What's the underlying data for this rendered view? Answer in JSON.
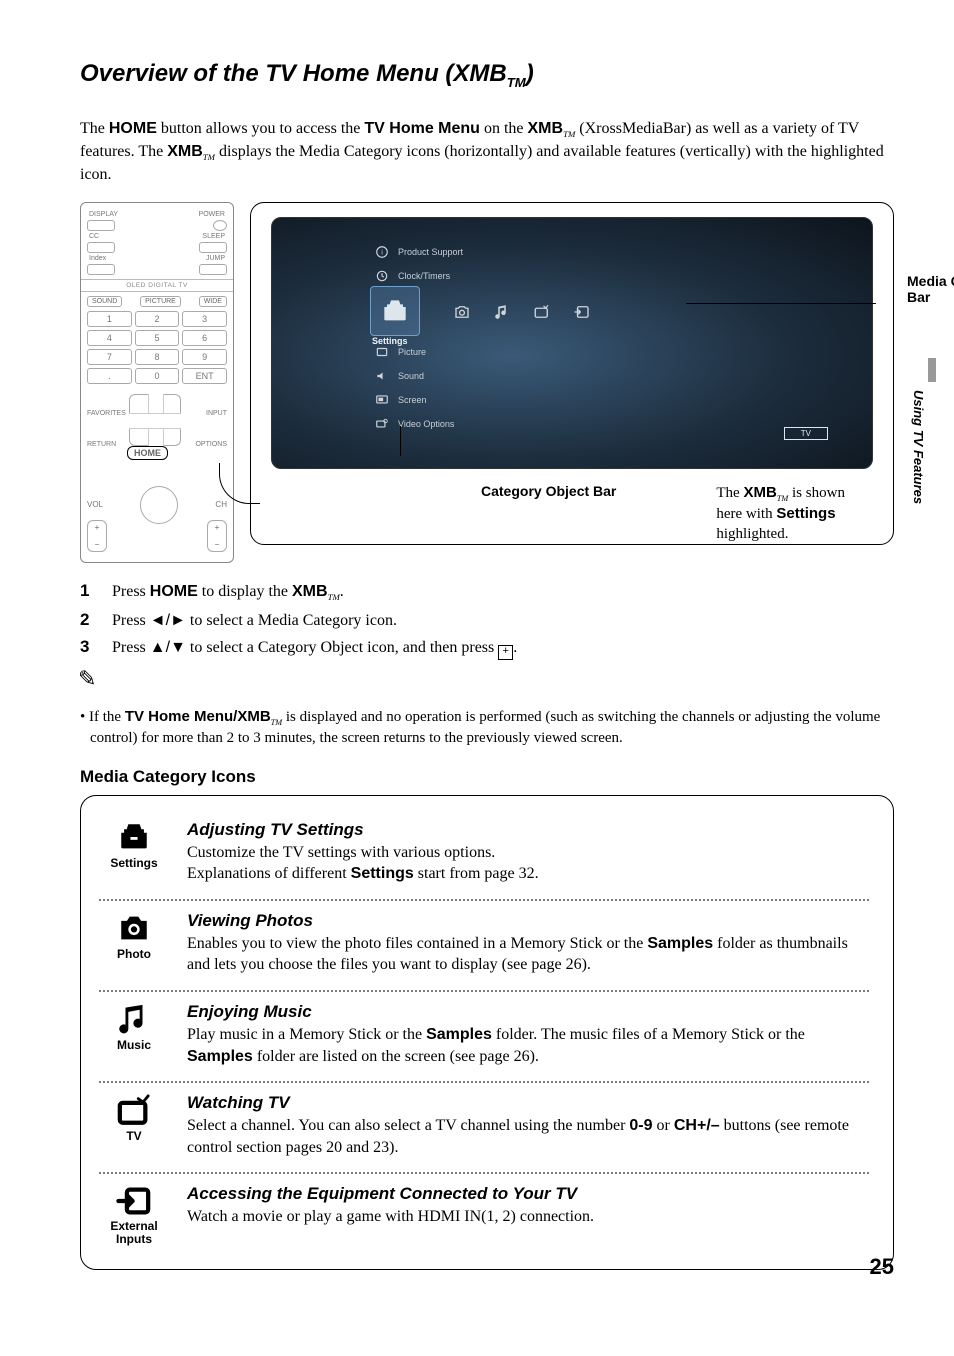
{
  "page_number": "25",
  "side_tab": "Using TV Features",
  "title_main": "Overview of the TV Home Menu (XMB",
  "title_tm": "TM",
  "title_close": ")",
  "intro_1a": "The ",
  "intro_home": "HOME",
  "intro_1b": " button allows you to access the ",
  "intro_tvhm": "TV Home Menu",
  "intro_1c": " on the ",
  "intro_xmb": "XMB",
  "intro_1d": " (XrossMediaBar) as well as a variety of TV features. The ",
  "intro_1e": " displays the Media Category icons (horizontally) and available features (vertically) with the highlighted icon.",
  "remote": {
    "top": {
      "l": "DISPLAY",
      "r": "POWER"
    },
    "row2": {
      "l": "CC",
      "r": "SLEEP"
    },
    "row3": {
      "l": "Index",
      "r": "JUMP"
    },
    "strip": "OLED DIGITAL TV",
    "row4": {
      "a": "SOUND",
      "b": "PICTURE",
      "c": "WIDE"
    },
    "keypad": [
      "1",
      "2",
      "3",
      "4",
      "5",
      "6",
      "7",
      "8",
      "9",
      ".",
      "0",
      "ENT"
    ],
    "fav": "FAVORITES",
    "input": "INPUT",
    "return": "RETURN",
    "options": "OPTIONS",
    "home": "HOME",
    "vol": "VOL",
    "ch": "CH",
    "plus": "+"
  },
  "screen": {
    "items_top": [
      "Product Support",
      "Clock/Timers"
    ],
    "sel_label": "Settings",
    "items_bottom": [
      "Picture",
      "Sound",
      "Screen",
      "Video Options"
    ],
    "tv_badge": "TV"
  },
  "callouts": {
    "mcb": "Media Category Bar",
    "cob": "Category Object Bar",
    "note_a": "The ",
    "note_b": " is shown here with ",
    "note_settings": "Settings",
    "note_c": " highlighted."
  },
  "steps": [
    {
      "n": "1",
      "a": "Press ",
      "b": "HOME",
      "c": " to display the ",
      "d": "XMB",
      "e": "."
    },
    {
      "n": "2",
      "a": "Press ",
      "arr": "◄/►",
      "c": " to select a Media Category icon."
    },
    {
      "n": "3",
      "a": "Press ",
      "arr": "▲/▼",
      "c": " to select a Category Object icon, and then press ",
      "plus": "+",
      "e": "."
    }
  ],
  "note_bullet_a": "• If the ",
  "note_bullet_b": "TV Home Menu/XMB",
  "note_bullet_c": " is displayed and no operation is performed (such as switching the channels or adjusting the volume control) for more than 2 to 3 minutes, the screen returns to the previously viewed screen.",
  "section_media": "Media Category Icons",
  "icons": [
    {
      "label": "Settings",
      "title": "Adjusting TV Settings",
      "desc_a": "Customize the TV settings with various options.\nExplanations of different ",
      "desc_bold": "Settings",
      "desc_b": " start from page 32."
    },
    {
      "label": "Photo",
      "title": "Viewing Photos",
      "desc_a": "Enables you to view the photo files contained in a Memory Stick or the ",
      "desc_bold": "Samples",
      "desc_b": " folder as thumbnails and lets you choose the files you want to display (see page 26)."
    },
    {
      "label": "Music",
      "title": "Enjoying Music",
      "desc_a": "Play music in a Memory Stick or the ",
      "desc_bold": "Samples",
      "desc_b": " folder. The music files of a Memory Stick or the ",
      "desc_bold2": "Samples",
      "desc_c": " folder are listed on the screen (see page 26)."
    },
    {
      "label": "TV",
      "title": "Watching TV",
      "desc_a": "Select a channel. You can also select a TV channel using the number ",
      "desc_bold": "0-9",
      "desc_mid": " or ",
      "desc_bold2": "CH+/–",
      "desc_b": " buttons (see remote control section pages 20 and 23)."
    },
    {
      "label": "External Inputs",
      "title": "Accessing the Equipment Connected to Your TV",
      "desc_a": "Watch a movie or play a game with HDMI IN(1, 2) connection."
    }
  ]
}
